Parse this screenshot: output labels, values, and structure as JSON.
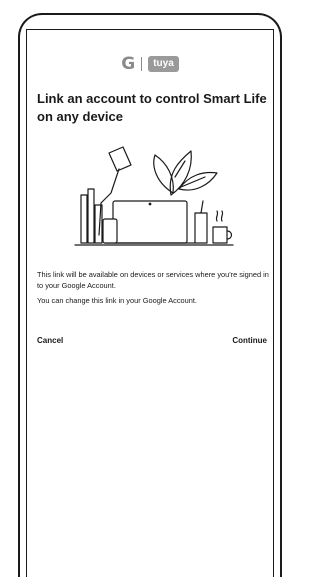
{
  "brand": {
    "google_logo_text": "G",
    "partner_logo_text": "tuya"
  },
  "dialog": {
    "title": "Link an account to control Smart Life on any device",
    "paragraph_1": "This link will be available on devices or services where you're signed in to your Google Account.",
    "paragraph_2": "You can change this link in your Google Account.",
    "cancel_label": "Cancel",
    "continue_label": "Continue"
  },
  "icons": {
    "illustration": "desk-devices-illustration",
    "google": "google-logo",
    "tuya": "tuya-logo"
  }
}
